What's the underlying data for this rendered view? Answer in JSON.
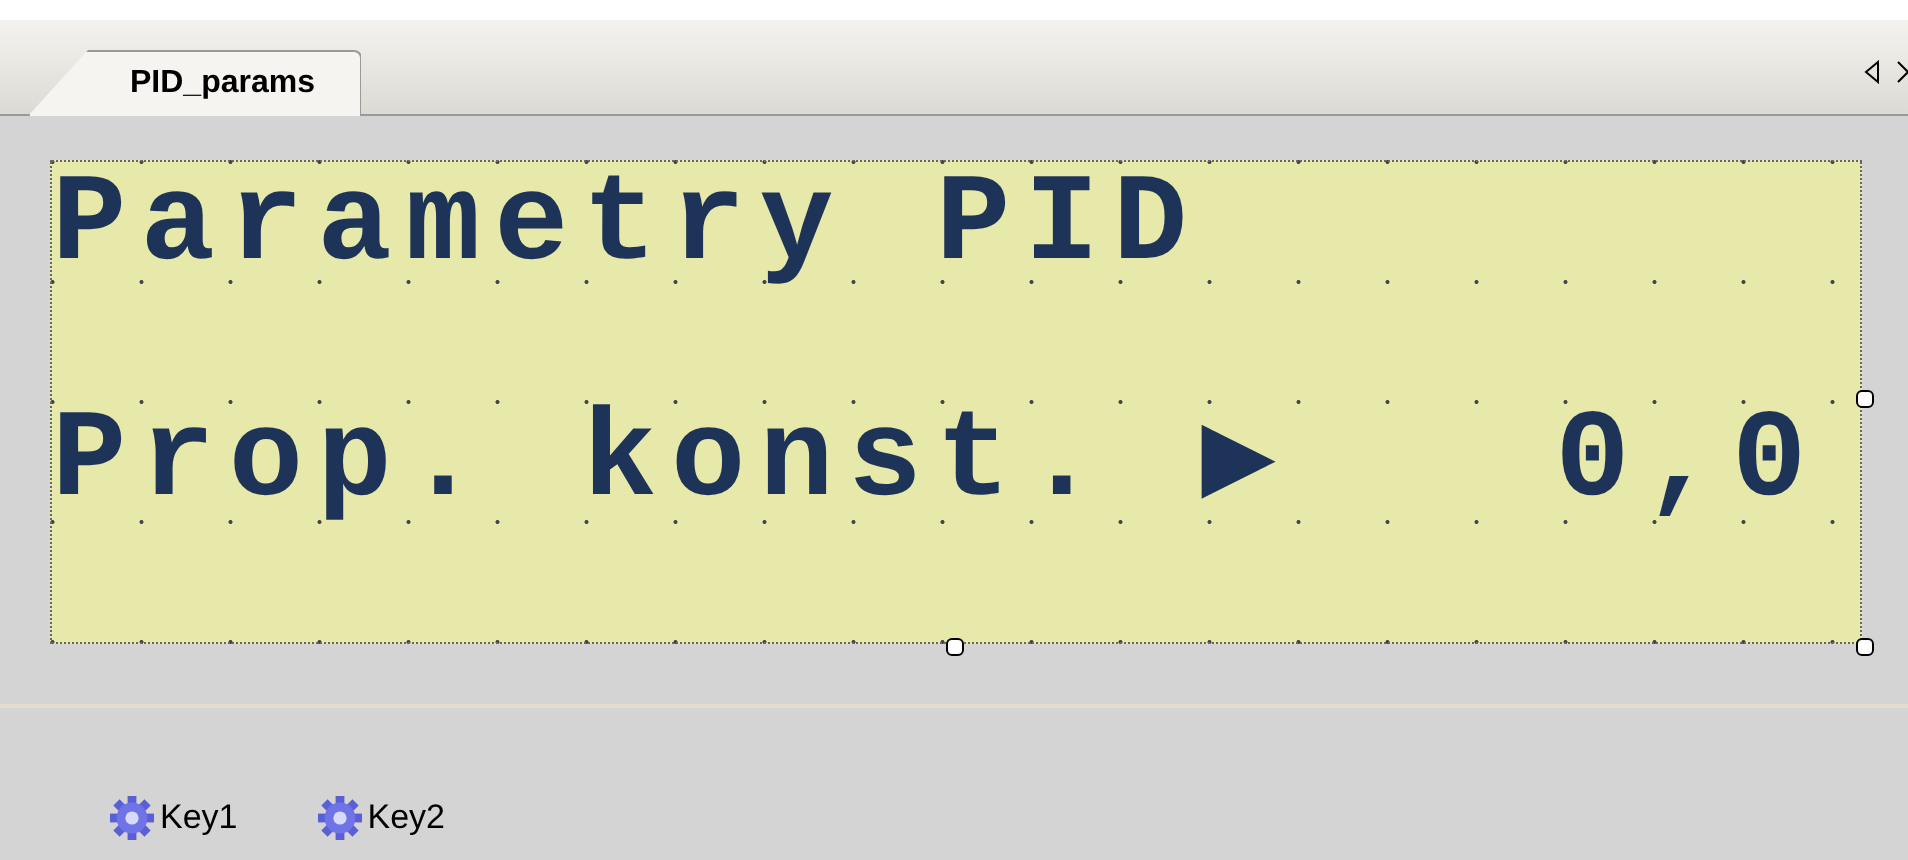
{
  "tabs": [
    {
      "label": "PID_params",
      "selected": true
    }
  ],
  "display": {
    "lines": [
      "Parametry PID",
      "Prop. konst. ▶   0,0"
    ]
  },
  "keys": [
    {
      "label": "Key1"
    },
    {
      "label": "Key2"
    }
  ]
}
